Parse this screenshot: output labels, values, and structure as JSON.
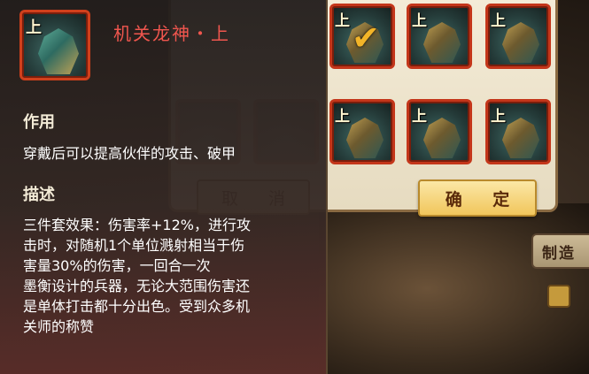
{
  "item": {
    "name": "机关龙神・上",
    "icon_name": "mecha-dragon-god-icon",
    "grade_tag": "上",
    "usage_heading": "作用",
    "usage_text": "穿戴后可以提高伙伴的攻击、破甲",
    "desc_heading": "描述",
    "desc_lines": [
      "三件套效果：伤害率+12%，进行攻",
      "击时，对随机1个单位溅射相当于伤",
      "害量30%的伤害，一回合一次",
      "墨衡设计的兵器，无论大范围伤害还",
      "是单体打击都十分出色。受到众多机",
      "关师的称赞"
    ],
    "name_color": "#f0564e"
  },
  "dialog": {
    "cancel_label": "取 消",
    "confirm_label": "确 定",
    "slots": [
      {
        "tag": "上",
        "selected": true
      },
      {
        "tag": "上",
        "selected": false
      },
      {
        "tag": "上",
        "selected": false
      },
      {
        "tag": "上",
        "selected": false
      },
      {
        "tag": "上",
        "selected": false
      },
      {
        "tag": "上",
        "selected": false
      }
    ]
  },
  "craft": {
    "label": "制造"
  }
}
